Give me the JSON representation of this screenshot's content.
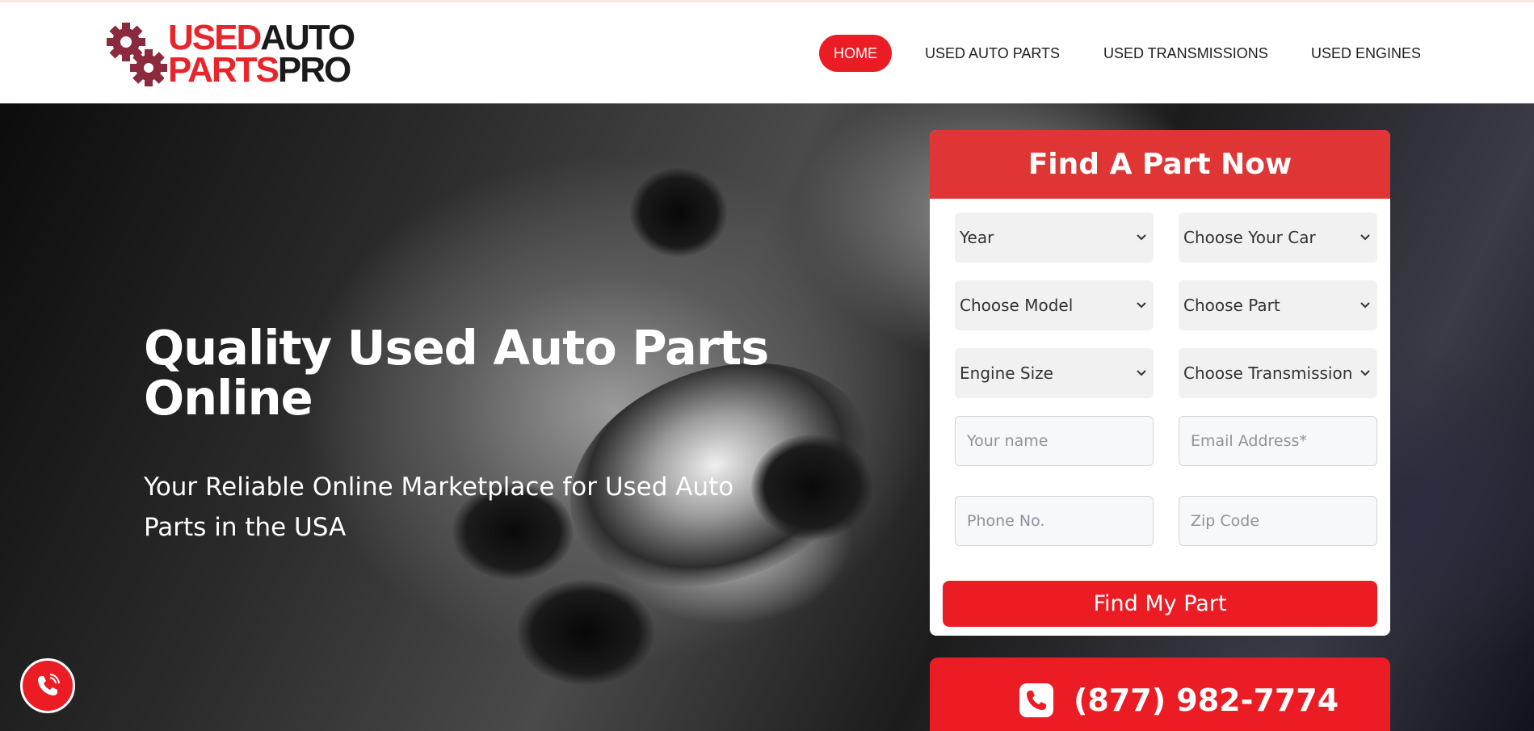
{
  "brand": {
    "logo_line1_red": "USED",
    "logo_line1_dark": "AUTO",
    "logo_line2_red": "PARTS",
    "logo_line2_dark": "PRO",
    "accent_color": "#ec1c24",
    "gear_color": "#8b2a3e"
  },
  "nav": {
    "items": [
      {
        "label": "HOME",
        "active": true
      },
      {
        "label": "USED AUTO PARTS",
        "active": false
      },
      {
        "label": "USED TRANSMISSIONS",
        "active": false
      },
      {
        "label": "USED ENGINES",
        "active": false
      }
    ]
  },
  "hero": {
    "title": "Quality Used Auto Parts Online",
    "subtitle": "Your Reliable Online Marketplace for Used Auto Parts in the USA"
  },
  "form": {
    "heading": "Find A Part Now",
    "selects": [
      {
        "value": "Year"
      },
      {
        "value": "Choose Your Car"
      },
      {
        "value": "Choose Model"
      },
      {
        "value": "Choose Part"
      },
      {
        "value": "Engine Size"
      },
      {
        "value": "Choose Transmission"
      }
    ],
    "inputs": [
      {
        "placeholder": "Your name",
        "value": ""
      },
      {
        "placeholder": "Email Address*",
        "value": ""
      },
      {
        "placeholder": "Phone No.",
        "value": ""
      },
      {
        "placeholder": "Zip Code",
        "value": ""
      }
    ],
    "submit_label": "Find My Part"
  },
  "phone": {
    "number": "(877) 982-7774",
    "icon": "phone-icon"
  },
  "floating_call": {
    "icon": "phone-icon"
  }
}
